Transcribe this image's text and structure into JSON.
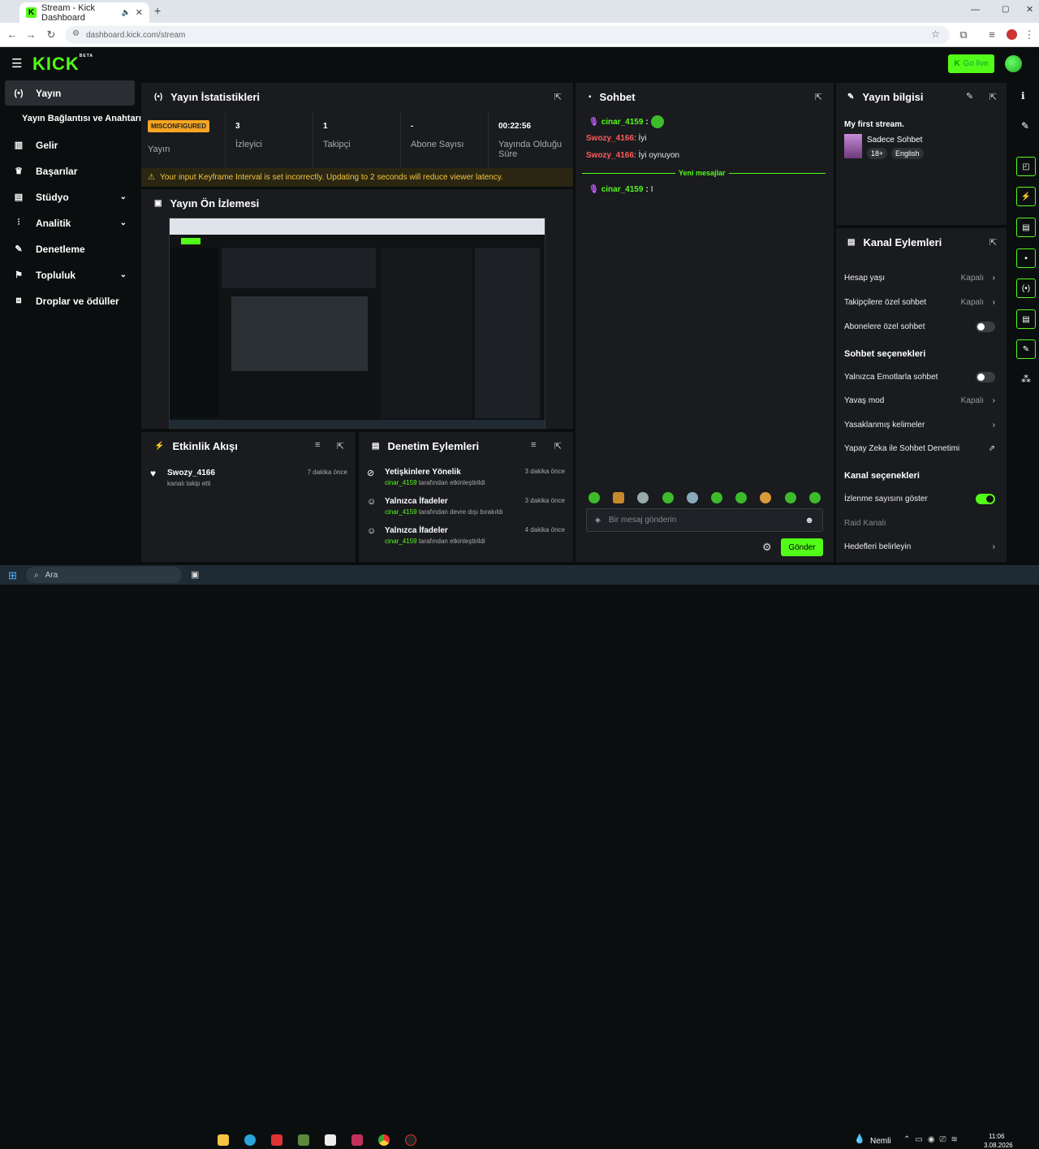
{
  "browser": {
    "tab_title": "Stream - Kick Dashboard",
    "url": "dashboard.kick.com/stream",
    "new_tab": "+"
  },
  "app": {
    "logo": "KICK",
    "logo_badge": "BETA",
    "go_live": "Go live"
  },
  "sidebar": {
    "items": [
      {
        "label": "Yayın",
        "icon": "broadcast-icon"
      },
      {
        "label": "Yayın Bağlantısı ve Anahtarı",
        "icon": ""
      },
      {
        "label": "Gelir",
        "icon": "chart-icon"
      },
      {
        "label": "Başarılar",
        "icon": "trophy-icon"
      },
      {
        "label": "Stüdyo",
        "icon": "studio-icon"
      },
      {
        "label": "Analitik",
        "icon": "analytics-icon"
      },
      {
        "label": "Denetleme",
        "icon": "wrench-icon"
      },
      {
        "label": "Topluluk",
        "icon": "community-icon"
      },
      {
        "label": "Droplar ve ödüller",
        "icon": "gift-icon"
      }
    ]
  },
  "stats": {
    "title": "Yayın İstatistikleri",
    "badge": "MISCONFIGURED",
    "items": [
      {
        "value": "",
        "label": "Yayın"
      },
      {
        "value": "3",
        "label": "İzleyici"
      },
      {
        "value": "1",
        "label": "Takipçi"
      },
      {
        "value": "-",
        "label": "Abone Sayısı"
      },
      {
        "value": "00:22:56",
        "label": "Yayında Olduğu Süre"
      }
    ],
    "warning": "Your input Keyframe Interval is set incorrectly. Updating to 2 seconds will reduce viewer latency."
  },
  "preview": {
    "title": "Yayın Ön İzlemesi"
  },
  "activity": {
    "title": "Etkinlik Akışı",
    "items": [
      {
        "user": "Swozy_4166",
        "text": "kanalı takip etti",
        "time": "7 dakika önce"
      }
    ]
  },
  "moderation": {
    "title": "Denetim Eylemleri",
    "items": [
      {
        "title": "Yetişkinlere Yönelik",
        "user": "cinar_4159",
        "text": "tarafından etkinleştirildi",
        "time": "3 dakika önce"
      },
      {
        "title": "Yalnızca İfadeler",
        "user": "cinar_4159",
        "text": "tarafından devre dışı bırakıldı",
        "time": "3 dakika önce"
      },
      {
        "title": "Yalnızca İfadeler",
        "user": "cinar_4159",
        "text": "tarafından etkinleştirildi",
        "time": "4 dakika önce"
      }
    ]
  },
  "chat": {
    "title": "Sohbet",
    "messages": [
      {
        "user": "cinar_4159",
        "text": "",
        "color": "#53fc18"
      },
      {
        "user": "Swozy_4166",
        "text": "İyi",
        "color": "#ff5a5a"
      },
      {
        "user": "Swozy_4166",
        "text": "İyi oynuyon",
        "color": "#ff5a5a"
      }
    ],
    "new_messages": "Yeni mesajlar",
    "after": {
      "user": "cinar_4159",
      "text": "I"
    },
    "placeholder": "Bir mesaj gönderin",
    "send": "Gönder"
  },
  "stream_info": {
    "title": "Yayın bilgisi",
    "stream_title": "My first stream.",
    "category": "Sadece Sohbet",
    "tags": [
      "18+",
      "English"
    ]
  },
  "channel_actions": {
    "title": "Kanal Eylemleri",
    "rows": [
      {
        "label": "Hesap yaşı",
        "value": "Kapalı",
        "type": "arrow"
      },
      {
        "label": "Takipçilere özel sohbet",
        "value": "Kapalı",
        "type": "arrow"
      },
      {
        "label": "Abonelere özel sohbet",
        "value": "",
        "type": "toggle-off"
      }
    ],
    "chat_options_title": "Sohbet seçenekleri",
    "chat_rows": [
      {
        "label": "Yalnızca Emotlarla sohbet",
        "value": "",
        "type": "toggle-off"
      },
      {
        "label": "Yavaş mod",
        "value": "Kapalı",
        "type": "arrow"
      },
      {
        "label": "Yasaklanmış kelimeler",
        "value": "",
        "type": "arrow"
      },
      {
        "label": "Yapay Zeka ile Sohbet Denetimi",
        "value": "",
        "type": "external"
      }
    ],
    "channel_options_title": "Kanal seçenekleri",
    "channel_rows": [
      {
        "label": "İzlenme sayısını göster",
        "value": "",
        "type": "toggle-on"
      },
      {
        "label": "Raid Kanalı",
        "value": "",
        "type": "none"
      },
      {
        "label": "Hedefleri belirleyin",
        "value": "",
        "type": "arrow"
      }
    ]
  },
  "taskbar": {
    "search": "Ara",
    "weather": "Nemli",
    "time": "11:06",
    "date": "3.08.2026"
  }
}
